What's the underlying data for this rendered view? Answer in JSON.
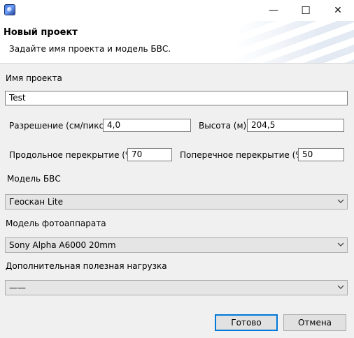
{
  "window": {
    "minimize_glyph": "—",
    "maximize_glyph": "☐",
    "close_glyph": "✕"
  },
  "header": {
    "title": "Новый проект",
    "subtitle": "Задайте имя проекта и модель БВС."
  },
  "form": {
    "project_name_label": "Имя проекта",
    "project_name_value": "Test",
    "resolution_label": "Разрешение (см/пикс)",
    "resolution_value": "4,0",
    "altitude_label": "Высота (м)",
    "altitude_value": "204,5",
    "forward_overlap_label": "Продольное перекрытие (%)",
    "forward_overlap_value": "70",
    "side_overlap_label": "Поперечное перекрытие (%)",
    "side_overlap_value": "50",
    "uav_model_label": "Модель БВС",
    "uav_model_selected": "Геоскан Lite",
    "camera_model_label": "Модель фотоаппарата",
    "camera_model_selected": "Sony Alpha A6000 20mm",
    "payload_label": "Дополнительная полезная нагрузка",
    "payload_selected": "——"
  },
  "buttons": {
    "ok_label": "Готово",
    "cancel_label": "Отмена"
  },
  "icons": {
    "app": "app-icon",
    "dropdown": "chevron-down-icon"
  }
}
